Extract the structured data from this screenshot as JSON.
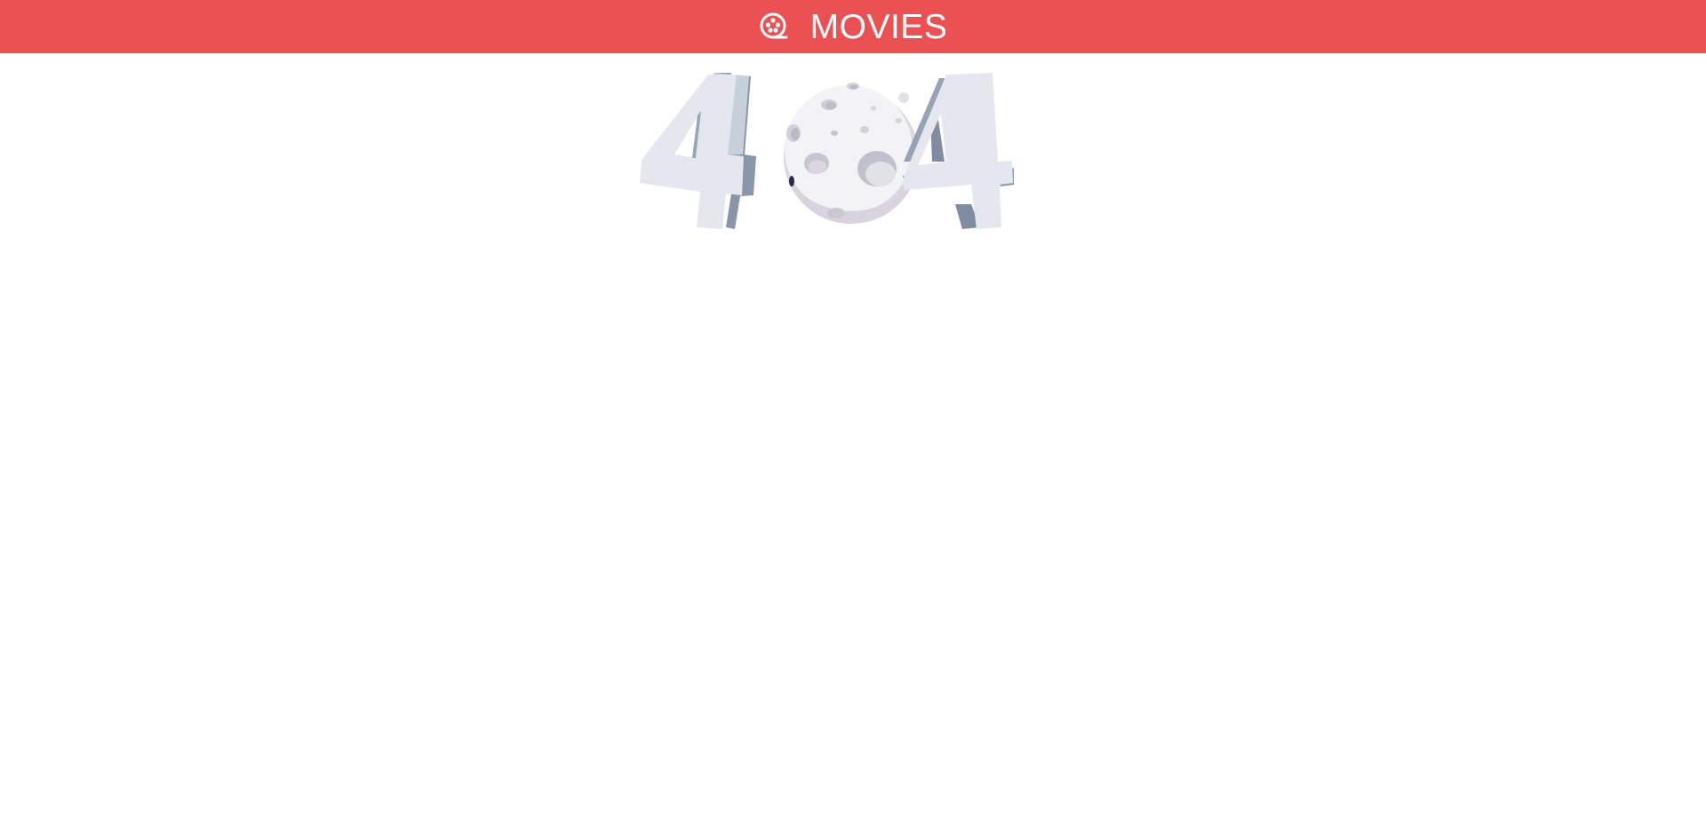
{
  "header": {
    "brand_label": "MOVIES",
    "brand_icon": "film-reel-icon",
    "background_color": "#eb5152",
    "text_color": "#ffffff"
  },
  "error_art": {
    "left_digit": "4",
    "middle_graphic": "moon-icon",
    "right_digit": "4"
  }
}
